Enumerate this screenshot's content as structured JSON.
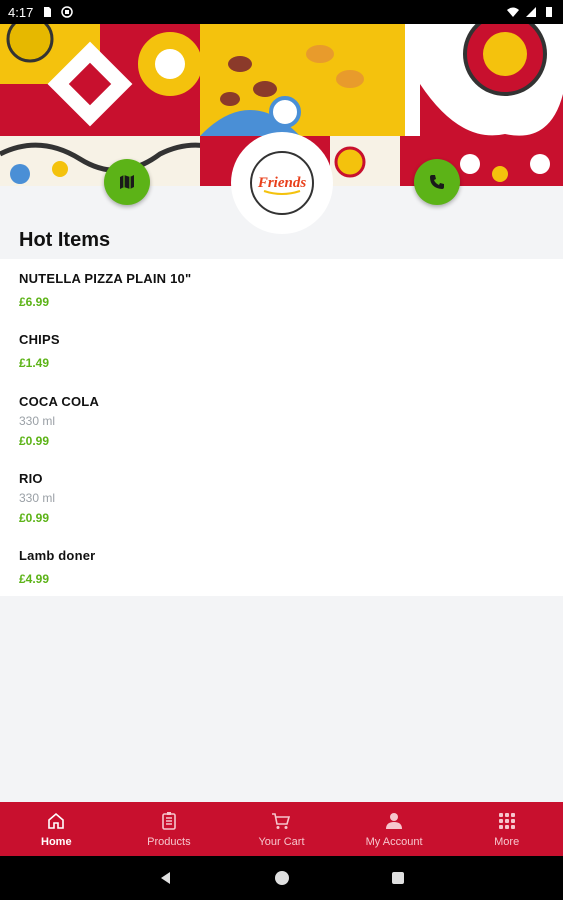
{
  "status_bar": {
    "time": "4:17",
    "icons_left": [
      "sd-card-icon",
      "notification-icon"
    ],
    "icons_right": [
      "wifi-icon",
      "signal-icon",
      "battery-icon"
    ]
  },
  "header": {
    "logo_text": "Friends",
    "map_button_icon": "map-icon",
    "phone_button_icon": "phone-icon"
  },
  "section": {
    "title": "Hot Items"
  },
  "items": [
    {
      "name": "NUTELLA PIZZA PLAIN 10\"",
      "sub": "",
      "price": "£6.99"
    },
    {
      "name": "CHIPS",
      "sub": "",
      "price": "£1.49"
    },
    {
      "name": "COCA COLA",
      "sub": "330 ml",
      "price": "£0.99"
    },
    {
      "name": "RIO",
      "sub": "330 ml",
      "price": "£0.99"
    },
    {
      "name": "Lamb doner",
      "sub": "",
      "price": "£4.99"
    }
  ],
  "bottom_nav": [
    {
      "label": "Home",
      "icon": "home-icon",
      "active": true
    },
    {
      "label": "Products",
      "icon": "menu-card-icon",
      "active": false
    },
    {
      "label": "Your Cart",
      "icon": "cart-icon",
      "active": false
    },
    {
      "label": "My Account",
      "icon": "account-icon",
      "active": false
    },
    {
      "label": "More",
      "icon": "grid-icon",
      "active": false
    }
  ],
  "colors": {
    "brand_red": "#c8102e",
    "accent_green": "#5cb317",
    "background": "#f3f4f6"
  }
}
